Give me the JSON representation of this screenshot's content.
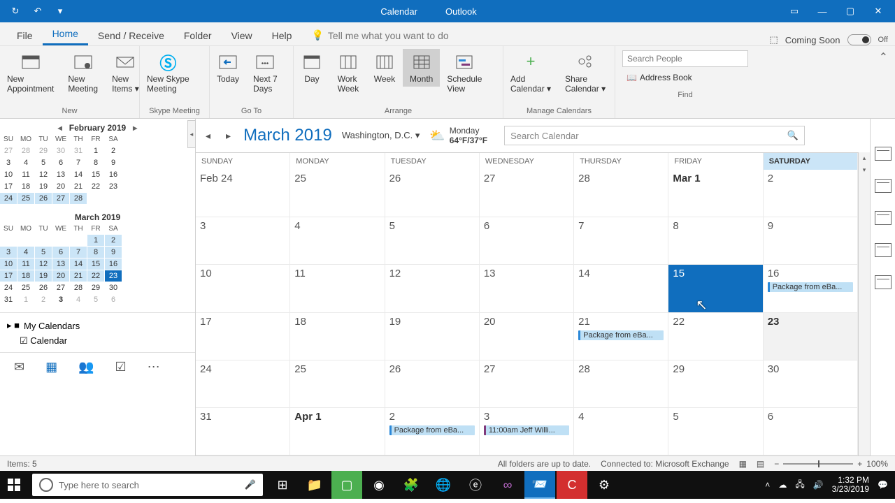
{
  "titlebar": {
    "app_left": "Calendar",
    "app_right": "Outlook"
  },
  "menu": {
    "tabs": [
      "File",
      "Home",
      "Send / Receive",
      "Folder",
      "View",
      "Help"
    ],
    "active": 1,
    "tell_me": "Tell me what you want to do",
    "coming_soon": "Coming Soon",
    "toggle_label": "Off"
  },
  "ribbon": {
    "new": {
      "label": "New",
      "appointment": "New\nAppointment",
      "meeting": "New\nMeeting",
      "items": "New\nItems ▾"
    },
    "skype": {
      "label": "Skype Meeting",
      "btn": "New Skype\nMeeting"
    },
    "goto": {
      "label": "Go To",
      "today": "Today",
      "next7": "Next 7\nDays"
    },
    "arrange": {
      "label": "Arrange",
      "day": "Day",
      "workweek": "Work\nWeek",
      "week": "Week",
      "month": "Month",
      "schedule": "Schedule\nView"
    },
    "manage": {
      "label": "Manage Calendars",
      "add": "Add\nCalendar ▾",
      "share": "Share\nCalendar ▾"
    },
    "find": {
      "label": "Find",
      "search_ph": "Search People",
      "address": "Address Book"
    }
  },
  "mini_cals": [
    {
      "title": "February 2019",
      "nav": true,
      "days": [
        [
          "SU",
          "MO",
          "TU",
          "WE",
          "TH",
          "FR",
          "SA"
        ],
        [
          {
            "n": "27",
            "dim": 1
          },
          {
            "n": "28",
            "dim": 1
          },
          {
            "n": "29",
            "dim": 1
          },
          {
            "n": "30",
            "dim": 1
          },
          {
            "n": "31",
            "dim": 1
          },
          {
            "n": "1"
          },
          {
            "n": "2"
          }
        ],
        [
          {
            "n": "3"
          },
          {
            "n": "4"
          },
          {
            "n": "5"
          },
          {
            "n": "6"
          },
          {
            "n": "7"
          },
          {
            "n": "8"
          },
          {
            "n": "9"
          }
        ],
        [
          {
            "n": "10"
          },
          {
            "n": "11"
          },
          {
            "n": "12"
          },
          {
            "n": "13"
          },
          {
            "n": "14"
          },
          {
            "n": "15"
          },
          {
            "n": "16"
          }
        ],
        [
          {
            "n": "17"
          },
          {
            "n": "18"
          },
          {
            "n": "19"
          },
          {
            "n": "20"
          },
          {
            "n": "21"
          },
          {
            "n": "22"
          },
          {
            "n": "23"
          }
        ],
        [
          {
            "n": "24",
            "hl": 1
          },
          {
            "n": "25",
            "hl": 1
          },
          {
            "n": "26",
            "hl": 1
          },
          {
            "n": "27",
            "hl": 1
          },
          {
            "n": "28",
            "hl": 1
          },
          {
            "n": ""
          },
          {
            "n": ""
          }
        ]
      ]
    },
    {
      "title": "March 2019",
      "nav": false,
      "days": [
        [
          "SU",
          "MO",
          "TU",
          "WE",
          "TH",
          "FR",
          "SA"
        ],
        [
          {
            "n": ""
          },
          {
            "n": ""
          },
          {
            "n": ""
          },
          {
            "n": ""
          },
          {
            "n": ""
          },
          {
            "n": "1",
            "hl": 1
          },
          {
            "n": "2",
            "hl": 1
          }
        ],
        [
          {
            "n": "3",
            "hl": 1
          },
          {
            "n": "4",
            "hl": 1
          },
          {
            "n": "5",
            "hl": 1
          },
          {
            "n": "6",
            "hl": 1
          },
          {
            "n": "7",
            "hl": 1
          },
          {
            "n": "8",
            "hl": 1
          },
          {
            "n": "9",
            "hl": 1
          }
        ],
        [
          {
            "n": "10",
            "hl": 1
          },
          {
            "n": "11",
            "hl": 1
          },
          {
            "n": "12",
            "hl": 1
          },
          {
            "n": "13",
            "hl": 1
          },
          {
            "n": "14",
            "hl": 1
          },
          {
            "n": "15",
            "hl": 1
          },
          {
            "n": "16",
            "hl": 1
          }
        ],
        [
          {
            "n": "17",
            "hl": 1
          },
          {
            "n": "18",
            "hl": 1
          },
          {
            "n": "19",
            "hl": 1
          },
          {
            "n": "20",
            "hl": 1
          },
          {
            "n": "21",
            "hl": 1
          },
          {
            "n": "22",
            "hl": 1
          },
          {
            "n": "23",
            "today": 1
          }
        ],
        [
          {
            "n": "24"
          },
          {
            "n": "25"
          },
          {
            "n": "26"
          },
          {
            "n": "27"
          },
          {
            "n": "28"
          },
          {
            "n": "29"
          },
          {
            "n": "30"
          }
        ],
        [
          {
            "n": "31"
          },
          {
            "n": "1",
            "dim": 1
          },
          {
            "n": "2",
            "dim": 1
          },
          {
            "n": "3",
            "bold": 1
          },
          {
            "n": "4",
            "dim": 1
          },
          {
            "n": "5",
            "dim": 1
          },
          {
            "n": "6",
            "dim": 1
          }
        ]
      ]
    }
  ],
  "mycals": {
    "header": "My Calendars",
    "items": [
      {
        "checked": true,
        "label": "Calendar"
      }
    ]
  },
  "cal_header": {
    "title": "March 2019",
    "location": "Washington,  D.C. ▾",
    "weather_day": "Monday",
    "weather_temp": "64°F/37°F",
    "search_ph": "Search Calendar"
  },
  "day_headers": [
    "SUNDAY",
    "MONDAY",
    "TUESDAY",
    "WEDNESDAY",
    "THURSDAY",
    "FRIDAY",
    "SATURDAY"
  ],
  "today_col": 6,
  "weeks": [
    [
      {
        "n": "Feb 24"
      },
      {
        "n": "25"
      },
      {
        "n": "26"
      },
      {
        "n": "27"
      },
      {
        "n": "28"
      },
      {
        "n": "Mar 1",
        "first": 1
      },
      {
        "n": "2"
      }
    ],
    [
      {
        "n": "3"
      },
      {
        "n": "4"
      },
      {
        "n": "5"
      },
      {
        "n": "6"
      },
      {
        "n": "7"
      },
      {
        "n": "8"
      },
      {
        "n": "9"
      }
    ],
    [
      {
        "n": "10"
      },
      {
        "n": "11"
      },
      {
        "n": "12"
      },
      {
        "n": "13"
      },
      {
        "n": "14"
      },
      {
        "n": "15",
        "selected": 1
      },
      {
        "n": "16",
        "events": [
          {
            "t": "Package from eBa..."
          }
        ]
      }
    ],
    [
      {
        "n": "17"
      },
      {
        "n": "18"
      },
      {
        "n": "19"
      },
      {
        "n": "20"
      },
      {
        "n": "21",
        "events": [
          {
            "t": "Package from eBa..."
          }
        ]
      },
      {
        "n": "22"
      },
      {
        "n": "23",
        "today": 1
      }
    ],
    [
      {
        "n": "24"
      },
      {
        "n": "25"
      },
      {
        "n": "26"
      },
      {
        "n": "27"
      },
      {
        "n": "28"
      },
      {
        "n": "29"
      },
      {
        "n": "30"
      }
    ],
    [
      {
        "n": "31"
      },
      {
        "n": "Apr 1",
        "first": 1
      },
      {
        "n": "2",
        "events": [
          {
            "t": "Package from eBa..."
          }
        ]
      },
      {
        "n": "3",
        "events": [
          {
            "t": "11:00am Jeff Willi...",
            "appt": 1
          }
        ]
      },
      {
        "n": "4"
      },
      {
        "n": "5"
      },
      {
        "n": "6"
      }
    ]
  ],
  "status": {
    "items": "Items: 5",
    "sync": "All folders are up to date.",
    "conn": "Connected to: Microsoft Exchange",
    "zoom": "100%"
  },
  "taskbar": {
    "search_ph": "Type here to search",
    "time": "1:32 PM",
    "date": "3/23/2019"
  }
}
